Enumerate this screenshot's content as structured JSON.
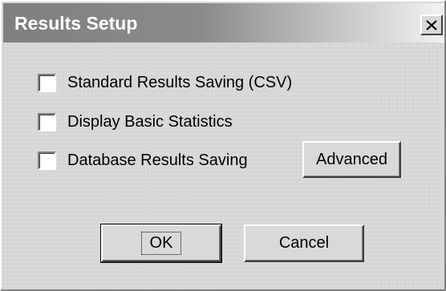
{
  "window": {
    "title": "Results Setup",
    "close_icon": "close-icon"
  },
  "options": [
    {
      "label": "Standard Results Saving (CSV)",
      "checked": false
    },
    {
      "label": "Display Basic Statistics",
      "checked": false
    },
    {
      "label": "Database Results Saving",
      "checked": false
    }
  ],
  "buttons": {
    "advanced": "Advanced",
    "ok": "OK",
    "cancel": "Cancel"
  },
  "colors": {
    "dialog_bg": "#d9d9d9",
    "titlebar_start": "#7f7f7f",
    "titlebar_end": "#f2f2f2"
  }
}
